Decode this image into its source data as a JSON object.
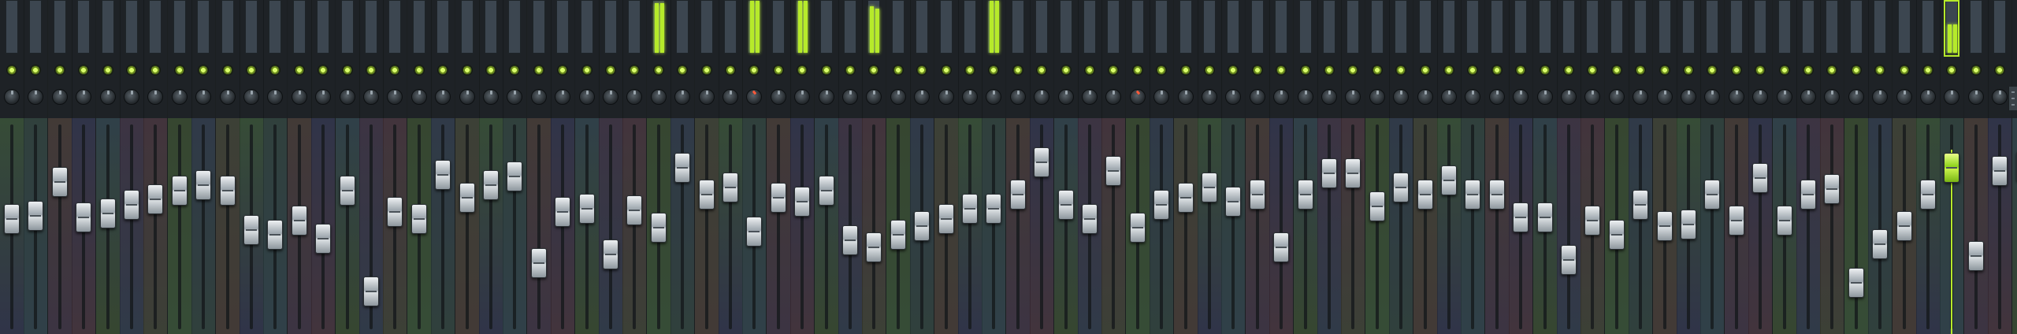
{
  "window": {
    "name": "mixer"
  },
  "colors": {
    "accent": "#b6ea2b",
    "background": "#2a3034",
    "fader": "#d8dde0"
  },
  "strip_palette": [
    "#4a7a3a",
    "#3a5a4a",
    "#6a4a3a",
    "#3a3a6a",
    "#3a5a6a",
    "#5a3a5a",
    "#6a3a4a",
    "#4a6a2a",
    "#3a4a6a",
    "#5a5a3a"
  ],
  "strips": [
    {
      "fader_level": 0.56,
      "meter": [
        0,
        0
      ],
      "knob_red": false
    },
    {
      "fader_level": 0.58,
      "meter": [
        0,
        0
      ],
      "knob_red": false
    },
    {
      "fader_level": 0.77,
      "meter": [
        0,
        0
      ],
      "knob_red": false
    },
    {
      "fader_level": 0.57,
      "meter": [
        0,
        0
      ],
      "knob_red": false
    },
    {
      "fader_level": 0.59,
      "meter": [
        0,
        0
      ],
      "knob_red": false
    },
    {
      "fader_level": 0.64,
      "meter": [
        0,
        0
      ],
      "knob_red": false
    },
    {
      "fader_level": 0.67,
      "meter": [
        0,
        0
      ],
      "knob_red": false
    },
    {
      "fader_level": 0.72,
      "meter": [
        0,
        0
      ],
      "knob_red": false
    },
    {
      "fader_level": 0.75,
      "meter": [
        0,
        0
      ],
      "knob_red": false
    },
    {
      "fader_level": 0.72,
      "meter": [
        0,
        0
      ],
      "knob_red": false
    },
    {
      "fader_level": 0.5,
      "meter": [
        0,
        0
      ],
      "knob_red": false
    },
    {
      "fader_level": 0.47,
      "meter": [
        0,
        0
      ],
      "knob_red": false
    },
    {
      "fader_level": 0.55,
      "meter": [
        0,
        0
      ],
      "knob_red": false
    },
    {
      "fader_level": 0.45,
      "meter": [
        0,
        0
      ],
      "knob_red": false
    },
    {
      "fader_level": 0.72,
      "meter": [
        0,
        0
      ],
      "knob_red": false
    },
    {
      "fader_level": 0.15,
      "meter": [
        0,
        0
      ],
      "knob_red": false
    },
    {
      "fader_level": 0.6,
      "meter": [
        0,
        0
      ],
      "knob_red": false
    },
    {
      "fader_level": 0.56,
      "meter": [
        0,
        0
      ],
      "knob_red": false
    },
    {
      "fader_level": 0.81,
      "meter": [
        0,
        0
      ],
      "knob_red": false
    },
    {
      "fader_level": 0.68,
      "meter": [
        0,
        0
      ],
      "knob_red": false
    },
    {
      "fader_level": 0.75,
      "meter": [
        0,
        0
      ],
      "knob_red": false
    },
    {
      "fader_level": 0.8,
      "meter": [
        0,
        0
      ],
      "knob_red": false
    },
    {
      "fader_level": 0.31,
      "meter": [
        0,
        0
      ],
      "knob_red": false
    },
    {
      "fader_level": 0.6,
      "meter": [
        0,
        0
      ],
      "knob_red": false
    },
    {
      "fader_level": 0.62,
      "meter": [
        0,
        0
      ],
      "knob_red": false
    },
    {
      "fader_level": 0.36,
      "meter": [
        0,
        0
      ],
      "knob_red": false
    },
    {
      "fader_level": 0.61,
      "meter": [
        0,
        0
      ],
      "knob_red": false
    },
    {
      "fader_level": 0.51,
      "meter": [
        0.96,
        0.96
      ],
      "knob_red": false
    },
    {
      "fader_level": 0.85,
      "meter": [
        0,
        0
      ],
      "knob_red": false
    },
    {
      "fader_level": 0.7,
      "meter": [
        0,
        0
      ],
      "knob_red": false
    },
    {
      "fader_level": 0.74,
      "meter": [
        0,
        0
      ],
      "knob_red": false
    },
    {
      "fader_level": 0.49,
      "meter": [
        1.0,
        1.0
      ],
      "knob_red": true
    },
    {
      "fader_level": 0.68,
      "meter": [
        0,
        0
      ],
      "knob_red": false
    },
    {
      "fader_level": 0.66,
      "meter": [
        1.0,
        1.0
      ],
      "knob_red": false
    },
    {
      "fader_level": 0.72,
      "meter": [
        0,
        0
      ],
      "knob_red": false
    },
    {
      "fader_level": 0.44,
      "meter": [
        0,
        0
      ],
      "knob_red": false
    },
    {
      "fader_level": 0.4,
      "meter": [
        0.9,
        0.85
      ],
      "knob_red": false
    },
    {
      "fader_level": 0.47,
      "meter": [
        0,
        0
      ],
      "knob_red": false
    },
    {
      "fader_level": 0.52,
      "meter": [
        0,
        0
      ],
      "knob_red": false
    },
    {
      "fader_level": 0.56,
      "meter": [
        0,
        0
      ],
      "knob_red": false
    },
    {
      "fader_level": 0.62,
      "meter": [
        0,
        0
      ],
      "knob_red": false
    },
    {
      "fader_level": 0.62,
      "meter": [
        1.0,
        1.0
      ],
      "knob_red": false
    },
    {
      "fader_level": 0.7,
      "meter": [
        0,
        0
      ],
      "knob_red": false
    },
    {
      "fader_level": 0.88,
      "meter": [
        0,
        0
      ],
      "knob_red": false
    },
    {
      "fader_level": 0.64,
      "meter": [
        0,
        0
      ],
      "knob_red": false
    },
    {
      "fader_level": 0.56,
      "meter": [
        0,
        0
      ],
      "knob_red": false
    },
    {
      "fader_level": 0.83,
      "meter": [
        0,
        0
      ],
      "knob_red": false
    },
    {
      "fader_level": 0.51,
      "meter": [
        0,
        0
      ],
      "knob_red": true
    },
    {
      "fader_level": 0.64,
      "meter": [
        0,
        0
      ],
      "knob_red": false
    },
    {
      "fader_level": 0.68,
      "meter": [
        0,
        0
      ],
      "knob_red": false
    },
    {
      "fader_level": 0.74,
      "meter": [
        0,
        0
      ],
      "knob_red": false
    },
    {
      "fader_level": 0.66,
      "meter": [
        0,
        0
      ],
      "knob_red": false
    },
    {
      "fader_level": 0.7,
      "meter": [
        0,
        0
      ],
      "knob_red": false
    },
    {
      "fader_level": 0.4,
      "meter": [
        0,
        0
      ],
      "knob_red": false
    },
    {
      "fader_level": 0.7,
      "meter": [
        0,
        0
      ],
      "knob_red": false
    },
    {
      "fader_level": 0.82,
      "meter": [
        0,
        0
      ],
      "knob_red": false
    },
    {
      "fader_level": 0.82,
      "meter": [
        0,
        0
      ],
      "knob_red": false
    },
    {
      "fader_level": 0.63,
      "meter": [
        0,
        0
      ],
      "knob_red": false
    },
    {
      "fader_level": 0.74,
      "meter": [
        0,
        0
      ],
      "knob_red": false
    },
    {
      "fader_level": 0.7,
      "meter": [
        0,
        0
      ],
      "knob_red": false
    },
    {
      "fader_level": 0.78,
      "meter": [
        0,
        0
      ],
      "knob_red": false
    },
    {
      "fader_level": 0.7,
      "meter": [
        0,
        0
      ],
      "knob_red": false
    },
    {
      "fader_level": 0.7,
      "meter": [
        0,
        0
      ],
      "knob_red": false
    },
    {
      "fader_level": 0.57,
      "meter": [
        0,
        0
      ],
      "knob_red": false
    },
    {
      "fader_level": 0.57,
      "meter": [
        0,
        0
      ],
      "knob_red": false
    },
    {
      "fader_level": 0.33,
      "meter": [
        0,
        0
      ],
      "knob_red": false
    },
    {
      "fader_level": 0.55,
      "meter": [
        0,
        0
      ],
      "knob_red": false
    },
    {
      "fader_level": 0.47,
      "meter": [
        0,
        0
      ],
      "knob_red": false
    },
    {
      "fader_level": 0.64,
      "meter": [
        0,
        0
      ],
      "knob_red": false
    },
    {
      "fader_level": 0.52,
      "meter": [
        0,
        0
      ],
      "knob_red": false
    },
    {
      "fader_level": 0.53,
      "meter": [
        0,
        0
      ],
      "knob_red": false
    },
    {
      "fader_level": 0.7,
      "meter": [
        0,
        0
      ],
      "knob_red": false
    },
    {
      "fader_level": 0.55,
      "meter": [
        0,
        0
      ],
      "knob_red": false
    },
    {
      "fader_level": 0.79,
      "meter": [
        0,
        0
      ],
      "knob_red": false
    },
    {
      "fader_level": 0.55,
      "meter": [
        0,
        0
      ],
      "knob_red": false
    },
    {
      "fader_level": 0.7,
      "meter": [
        0,
        0
      ],
      "knob_red": false
    },
    {
      "fader_level": 0.73,
      "meter": [
        0,
        0
      ],
      "knob_red": false
    },
    {
      "fader_level": 0.2,
      "meter": [
        0,
        0
      ],
      "knob_red": false
    },
    {
      "fader_level": 0.42,
      "meter": [
        0,
        0
      ],
      "knob_red": false
    },
    {
      "fader_level": 0.52,
      "meter": [
        0,
        0
      ],
      "knob_red": false
    },
    {
      "fader_level": 0.7,
      "meter": [
        0,
        0
      ],
      "knob_red": false
    },
    {
      "fader_level": 0.85,
      "meter": [
        0.55,
        0.55
      ],
      "knob_red": false,
      "selected": true
    },
    {
      "fader_level": 0.35,
      "meter": [
        0,
        0
      ],
      "knob_red": false
    },
    {
      "fader_level": 0.83,
      "meter": [
        0,
        0
      ],
      "knob_red": false
    },
    {
      "fader_level": 0.86,
      "meter": [
        0,
        0
      ],
      "knob_red": false
    }
  ]
}
